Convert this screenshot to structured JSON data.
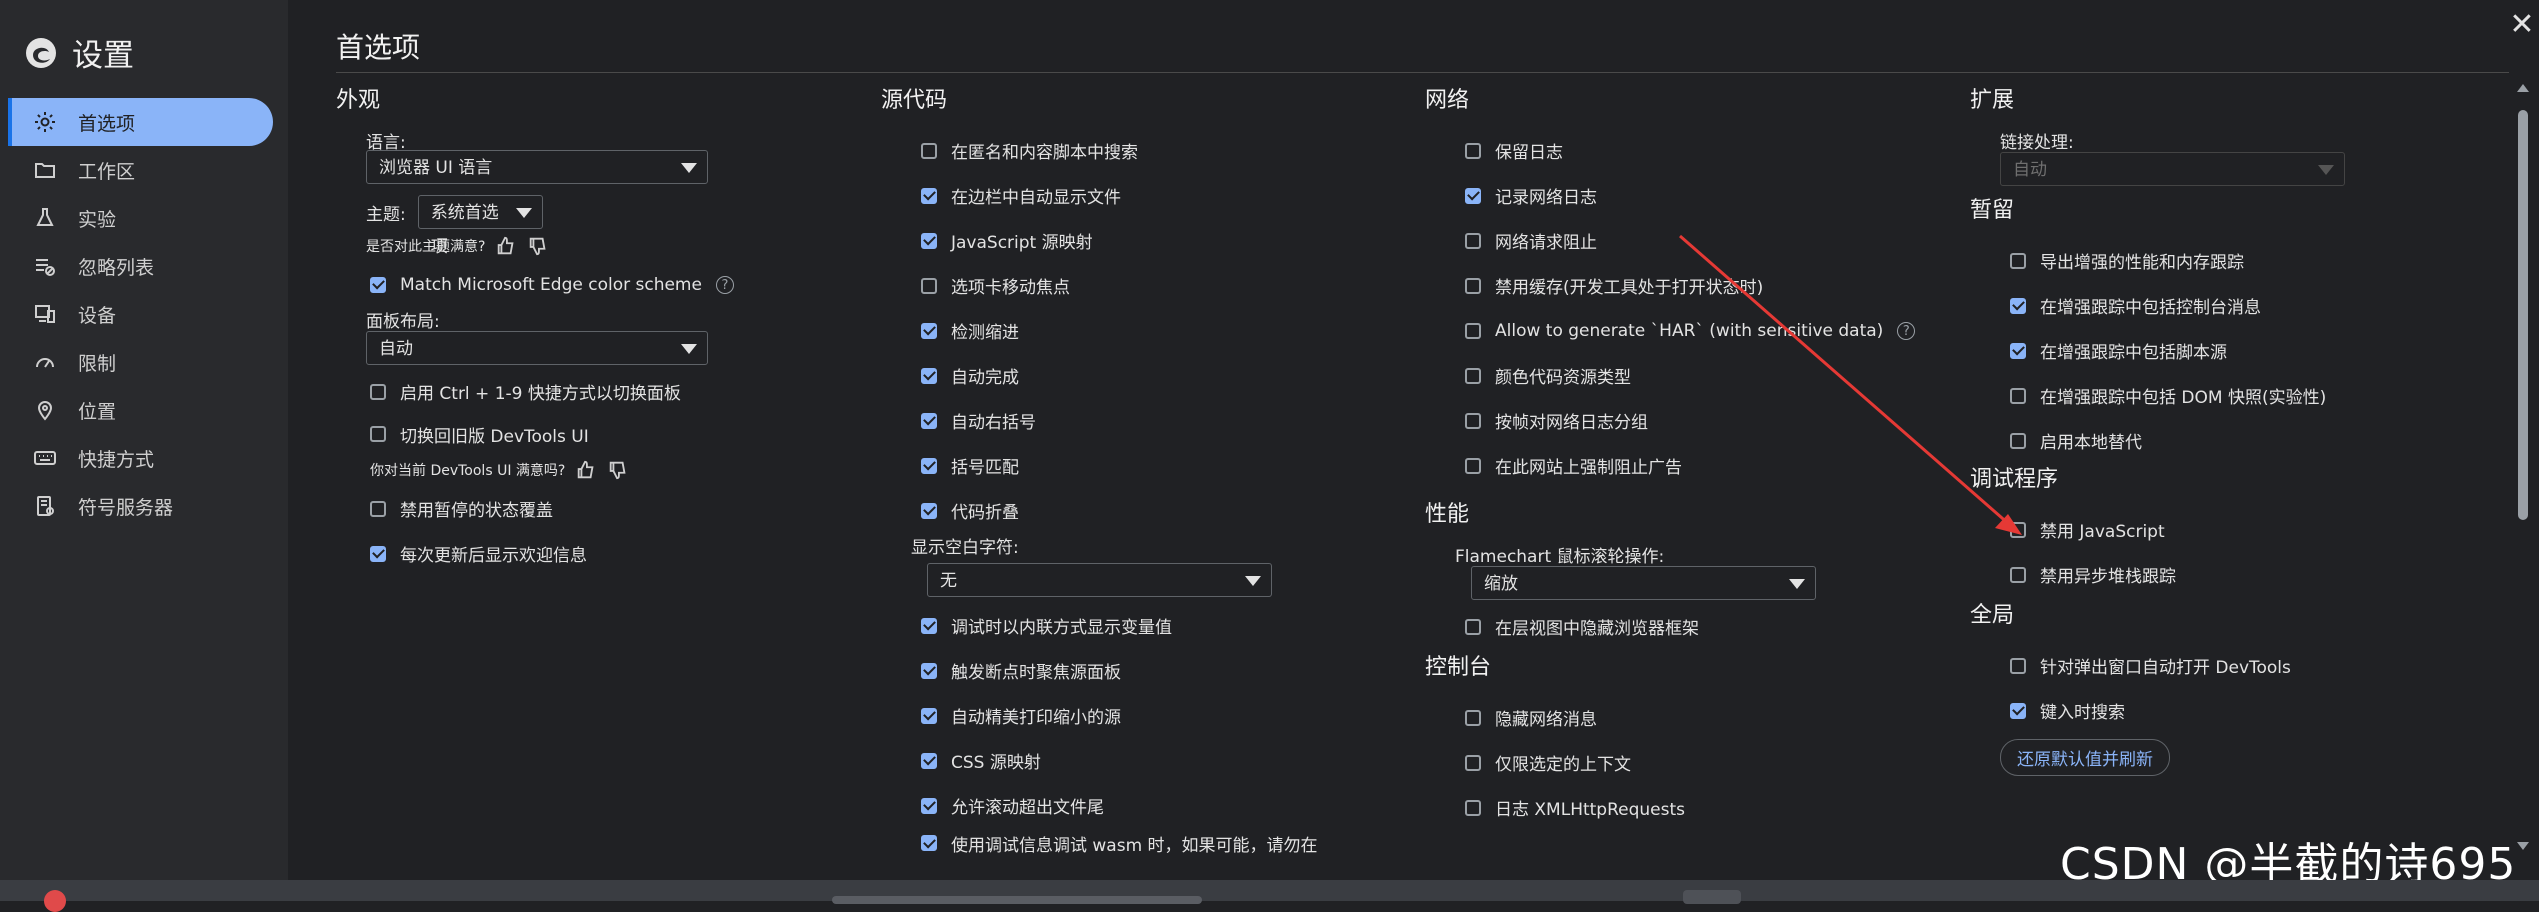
{
  "sidebar": {
    "title": "设置",
    "items": [
      {
        "label": "首选项",
        "icon": "gear-icon",
        "active": true
      },
      {
        "label": "工作区",
        "icon": "folder-icon",
        "active": false
      },
      {
        "label": "实验",
        "icon": "flask-icon",
        "active": false
      },
      {
        "label": "忽略列表",
        "icon": "ignore-list-icon",
        "active": false
      },
      {
        "label": "设备",
        "icon": "devices-icon",
        "active": false
      },
      {
        "label": "限制",
        "icon": "speedometer-icon",
        "active": false
      },
      {
        "label": "位置",
        "icon": "location-pin-icon",
        "active": false
      },
      {
        "label": "快捷方式",
        "icon": "keyboard-icon",
        "active": false
      },
      {
        "label": "符号服务器",
        "icon": "symbol-server-icon",
        "active": false
      }
    ]
  },
  "header": {
    "title": "首选项",
    "close_label": "✕"
  },
  "appearance": {
    "title": "外观",
    "language_label": "语言:",
    "language_value": "浏览器 UI 语言",
    "theme_label": "主题:",
    "theme_value": "系统首选项",
    "theme_feedback": "是否对此主题满意?",
    "match_edge": "Match Microsoft Edge color scheme",
    "panel_layout_label": "面板布局:",
    "panel_layout_value": "自动",
    "ctrl_switch": "启用 Ctrl + 1-9 快捷方式以切换面板",
    "old_devtools": "切换回旧版 DevTools UI",
    "devtools_feedback": "你对当前 DevTools UI 满意吗?",
    "disable_paused_overlay": "禁用暂停的状态覆盖",
    "show_welcome": "每次更新后显示欢迎信息"
  },
  "sources": {
    "title": "源代码",
    "items": [
      {
        "label": "在匿名和内容脚本中搜索",
        "checked": false
      },
      {
        "label": "在边栏中自动显示文件",
        "checked": true
      },
      {
        "label": "JavaScript 源映射",
        "checked": true
      },
      {
        "label": "选项卡移动焦点",
        "checked": false
      },
      {
        "label": "检测缩进",
        "checked": true
      },
      {
        "label": "自动完成",
        "checked": true
      },
      {
        "label": "自动右括号",
        "checked": true
      },
      {
        "label": "括号匹配",
        "checked": true
      },
      {
        "label": "代码折叠",
        "checked": true
      }
    ],
    "whitespace_label": "显示空白字符:",
    "whitespace_value": "无",
    "items2": [
      {
        "label": "调试时以内联方式显示变量值",
        "checked": true
      },
      {
        "label": "触发断点时聚焦源面板",
        "checked": true
      },
      {
        "label": "自动精美打印缩小的源",
        "checked": true
      },
      {
        "label": "CSS 源映射",
        "checked": true
      },
      {
        "label": "允许滚动超出文件尾",
        "checked": true
      }
    ],
    "cut_item": "使用调试信息调试 wasm 时，如果可能，请勿在"
  },
  "network": {
    "title": "网络",
    "items": [
      {
        "label": "保留日志",
        "checked": false
      },
      {
        "label": "记录网络日志",
        "checked": true
      },
      {
        "label": "网络请求阻止",
        "checked": false
      },
      {
        "label": "禁用缓存(开发工具处于打开状态时)",
        "checked": false
      },
      {
        "label": "Allow to generate `HAR` (with sensitive data)",
        "checked": false
      },
      {
        "label": "颜色代码资源类型",
        "checked": false
      },
      {
        "label": "按帧对网络日志分组",
        "checked": false
      },
      {
        "label": "在此网站上强制阻止广告",
        "checked": false
      }
    ]
  },
  "performance": {
    "title": "性能",
    "flamechart_label": "Flamechart 鼠标滚轮操作:",
    "flamechart_value": "缩放",
    "hide_chrome_frame": "在层视图中隐藏浏览器框架"
  },
  "console": {
    "title": "控制台",
    "items": [
      {
        "label": "隐藏网络消息",
        "checked": false
      },
      {
        "label": "仅限选定的上下文",
        "checked": false
      },
      {
        "label": "日志 XMLHttpRequests",
        "checked": false
      }
    ]
  },
  "extensions": {
    "title": "扩展",
    "link_label": "链接处理:",
    "link_value": "自动"
  },
  "persistence": {
    "title": "暂留",
    "items": [
      {
        "label": "导出增强的性能和内存跟踪",
        "checked": false
      },
      {
        "label": "在增强跟踪中包括控制台消息",
        "checked": true
      },
      {
        "label": "在增强跟踪中包括脚本源",
        "checked": true
      },
      {
        "label": "在增强跟踪中包括 DOM 快照(实验性)",
        "checked": false
      },
      {
        "label": "启用本地替代",
        "checked": false
      }
    ]
  },
  "debugger": {
    "title": "调试程序",
    "items": [
      {
        "label": "禁用 JavaScript",
        "checked": false
      },
      {
        "label": "禁用异步堆栈跟踪",
        "checked": false
      }
    ]
  },
  "global": {
    "title": "全局",
    "items": [
      {
        "label": "针对弹出窗口自动打开 DevTools",
        "checked": false
      },
      {
        "label": "键入时搜索",
        "checked": true
      }
    ],
    "reset_label": "还原默认值并刷新"
  },
  "watermark": "CSDN @半截的诗695",
  "colors": {
    "accent": "#8ab4f8",
    "background": "#202124",
    "sidebar": "#292a2d",
    "annotation_arrow": "#e53935"
  }
}
